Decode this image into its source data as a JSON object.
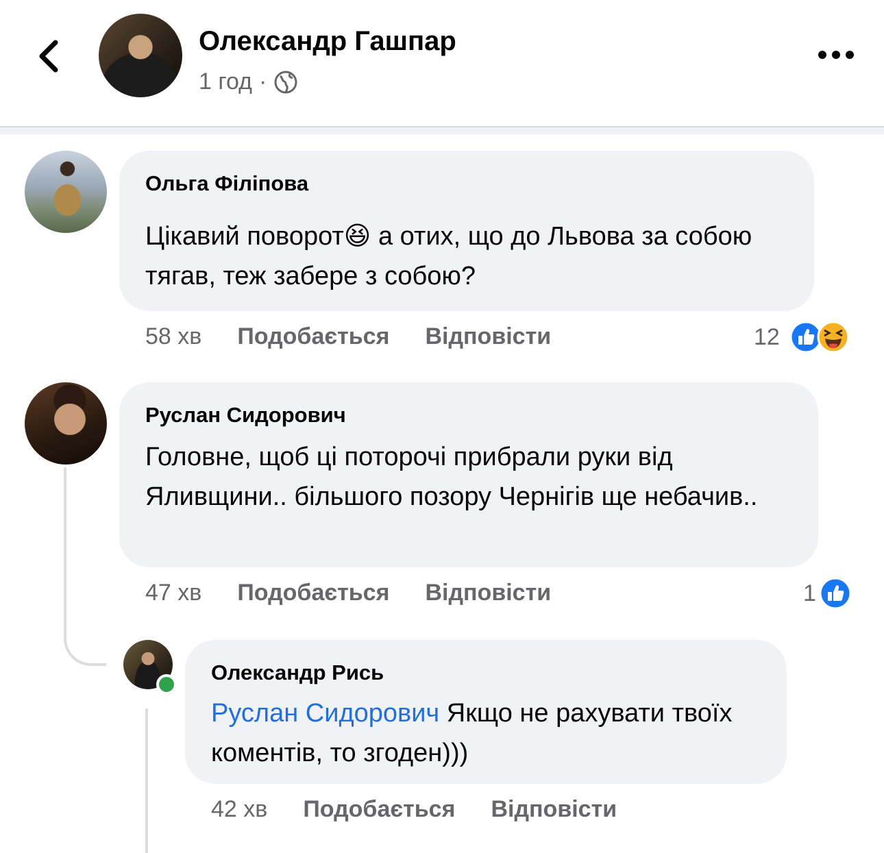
{
  "post": {
    "author": "Олександр Гашпар",
    "time": "1 год",
    "separator": "·",
    "privacy_icon": "globe-icon"
  },
  "icons": {
    "back": "chevron-left-icon",
    "more": "more-horizontal-icon"
  },
  "colors": {
    "bubble": "#f0f2f5",
    "secondary_text": "#65676b",
    "link": "#216fdb",
    "like_blue": "#1877f2",
    "online_green": "#31a24c"
  },
  "comments": [
    {
      "author": "Ольга Філіпова",
      "text_start": "Цікавий поворот",
      "emoji": "😆",
      "text_end": " а отих, що до Львова за собою тягав, теж забере з собою?",
      "time": "58 хв",
      "like_label": "Подобається",
      "reply_label": "Відповісти",
      "reaction_count": "12",
      "reactions": [
        "like-icon",
        "haha-icon"
      ]
    },
    {
      "author": "Руслан Сидорович",
      "text": "Головне, щоб ці поторочі прибрали руки від Яливщини.. більшого позору Чернігів ще небачив..",
      "time": "47 хв",
      "like_label": "Подобається",
      "reply_label": "Відповісти",
      "reaction_count": "1",
      "reactions": [
        "like-icon"
      ]
    },
    {
      "author": "Олександр Рись",
      "mention": "Руслан Сидорович",
      "text": " Якщо не рахувати твоїх коментів, то згоден)))",
      "time": "42 хв",
      "like_label": "Подобається",
      "reply_label": "Відповісти"
    }
  ]
}
